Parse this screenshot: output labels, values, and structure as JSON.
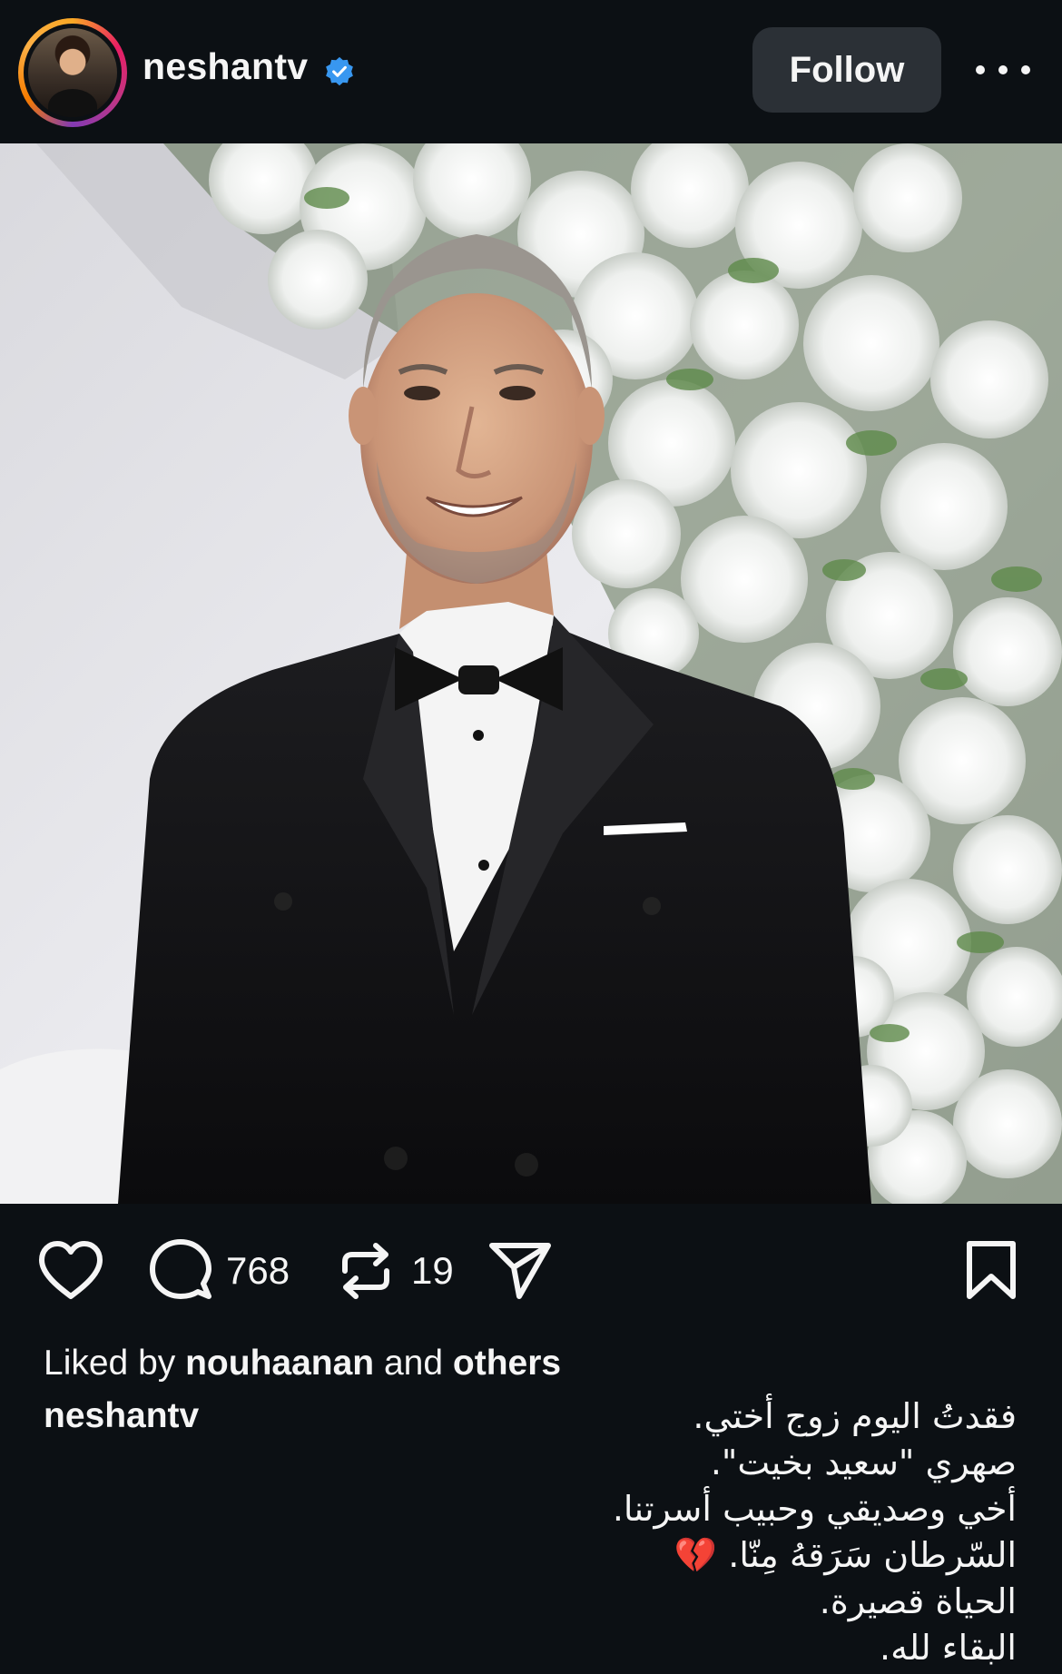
{
  "header": {
    "username": "neshantv",
    "verified": true,
    "follow_label": "Follow",
    "avatar_icon": "profile-avatar",
    "more_icon": "more-horizontal-icon"
  },
  "post": {
    "image_alt": "Man in black tuxedo with bow tie standing in front of white flower arrangement"
  },
  "actions": {
    "like_icon": "heart-icon",
    "comment_icon": "comment-icon",
    "comment_count": "768",
    "repost_icon": "repost-icon",
    "repost_count": "19",
    "share_icon": "send-icon",
    "save_icon": "bookmark-icon"
  },
  "likes": {
    "prefix": "Liked by",
    "user": "nouhaanan",
    "connector": "and",
    "others": "others"
  },
  "caption": {
    "username": "neshantv",
    "lines": [
      "فقدتُ اليوم زوج أختي.",
      "صهري \"سعيد بخيت\".",
      "أخي وصديقي وحبيب أسرتنا.",
      "السّرطان سَرَقهُ مِنّا. 💔",
      "الحياة قصيرة.",
      "البقاء لله."
    ]
  },
  "colors": {
    "background": "#0c1014",
    "button": "#2b3036",
    "verified": "#3897f0",
    "text": "#f5f5f5"
  }
}
